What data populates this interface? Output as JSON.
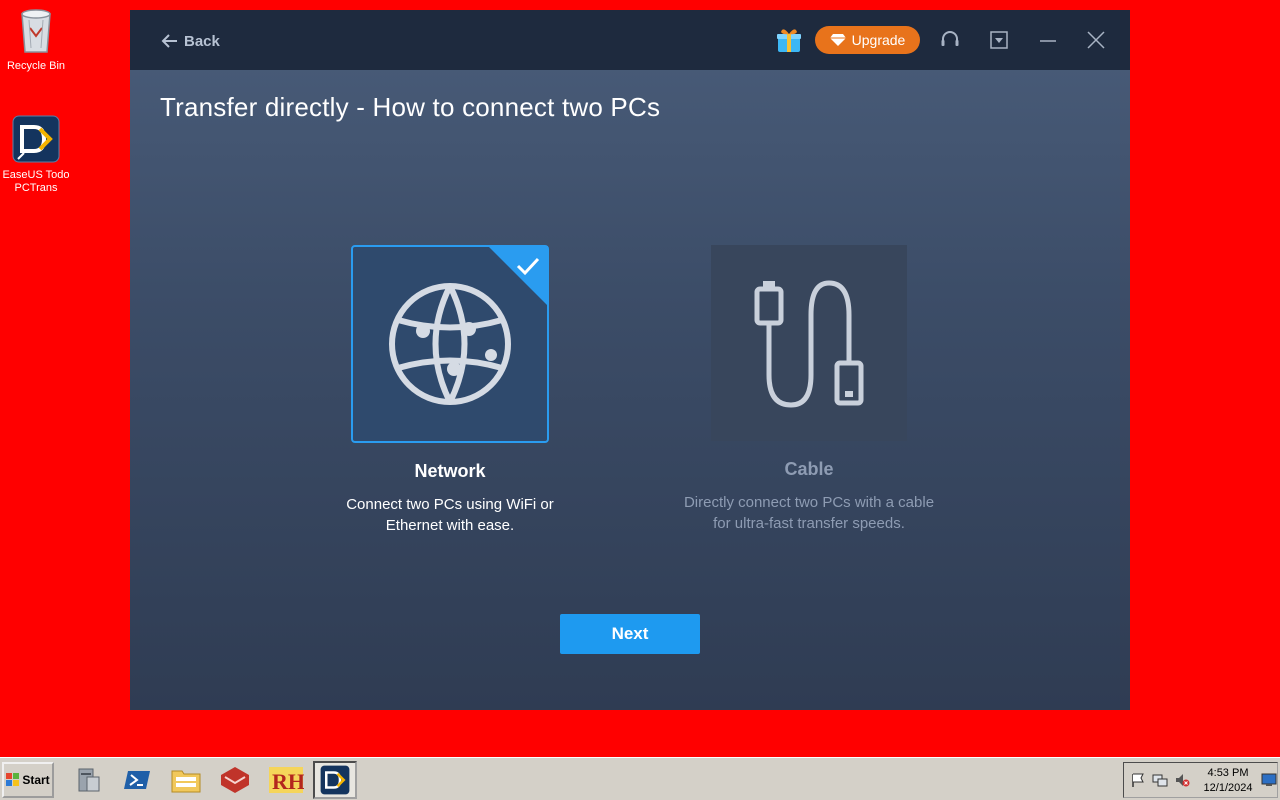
{
  "desktop": {
    "icons": [
      {
        "label": "Recycle Bin"
      },
      {
        "label": "EaseUS Todo PCTrans"
      }
    ]
  },
  "window": {
    "back_label": "Back",
    "upgrade_label": "Upgrade",
    "title": "Transfer directly - How to connect two PCs",
    "options": [
      {
        "title": "Network",
        "description": "Connect two PCs using WiFi or Ethernet with ease.",
        "selected": true,
        "icon": "globe-icon"
      },
      {
        "title": "Cable",
        "description": "Directly connect two PCs with a cable for ultra-fast transfer speeds.",
        "selected": false,
        "icon": "usb-cable-icon"
      }
    ],
    "next_label": "Next",
    "colors": {
      "accent": "#1e9af0",
      "upgrade": "#e8731b",
      "titlebar": "#1e2a3e"
    }
  },
  "taskbar": {
    "start_label": "Start",
    "clock_time": "4:53 PM",
    "clock_date": "12/1/2024"
  }
}
